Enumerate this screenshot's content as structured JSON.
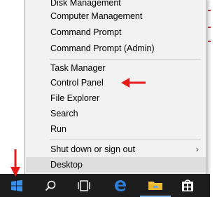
{
  "menu": {
    "items": [
      {
        "label": "Disk Management"
      },
      {
        "label": "Computer Management"
      },
      {
        "label": "Command Prompt"
      },
      {
        "label": "Command Prompt (Admin)"
      },
      {
        "label": "Task Manager"
      },
      {
        "label": "Control Panel"
      },
      {
        "label": "File Explorer"
      },
      {
        "label": "Search"
      },
      {
        "label": "Run"
      },
      {
        "label": "Shut down or sign out"
      },
      {
        "label": "Desktop"
      }
    ],
    "highlighted_item": "Desktop",
    "annotated_item": "Control Panel"
  },
  "taskbar": {
    "items": [
      {
        "icon": "windows-start-icon"
      },
      {
        "icon": "search-icon"
      },
      {
        "icon": "task-view-icon"
      },
      {
        "icon": "edge-browser-icon"
      },
      {
        "icon": "file-explorer-icon"
      },
      {
        "icon": "store-icon"
      }
    ]
  },
  "colors": {
    "taskbar": "#1d1d1d",
    "menu_bg": "#f2f2f2",
    "highlight": "#dedede",
    "windows_blue": "#3c8fe6",
    "edge_blue": "#2e7dd8",
    "folder_yellow": "#f4c542",
    "annotation_red": "#e81b1b"
  }
}
